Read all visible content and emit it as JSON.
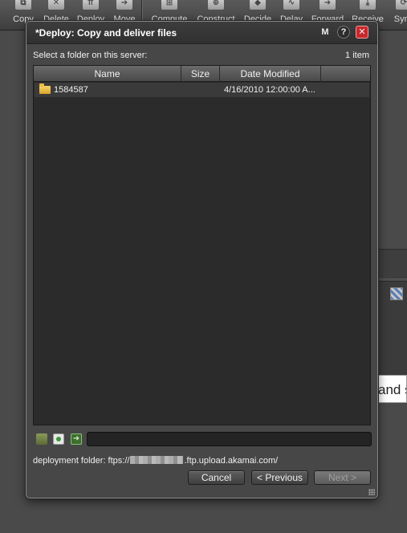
{
  "toolbar": {
    "items": [
      {
        "label": "Copy",
        "icon": "copy-icon",
        "glyph": "⧉"
      },
      {
        "label": "Delete",
        "icon": "delete-icon",
        "glyph": "✕"
      },
      {
        "label": "Deploy",
        "icon": "deploy-icon",
        "glyph": "⇈"
      },
      {
        "label": "Move",
        "icon": "move-icon",
        "glyph": "➔"
      },
      {
        "label": "Compute",
        "icon": "compute-icon",
        "glyph": "⊞"
      },
      {
        "label": "Construct",
        "icon": "construct-icon",
        "glyph": "⊕"
      },
      {
        "label": "Decide",
        "icon": "decide-icon",
        "glyph": "◆"
      },
      {
        "label": "Delay",
        "icon": "delay-icon",
        "glyph": "∿"
      },
      {
        "label": "Forward",
        "icon": "forward-icon",
        "glyph": "➜"
      },
      {
        "label": "Receive",
        "icon": "receive-icon",
        "glyph": "⤓"
      },
      {
        "label": "Sync",
        "icon": "sync-icon",
        "glyph": "⟳"
      }
    ]
  },
  "background": {
    "text_fragment": "and s"
  },
  "dialog": {
    "title": "*Deploy: Copy and deliver files",
    "title_buttons": {
      "m": "M",
      "help": "?",
      "close": "✕"
    },
    "select_label": "Select a folder on this server:",
    "item_count": "1 item",
    "columns": {
      "name": "Name",
      "size": "Size",
      "date": "Date Modified"
    },
    "rows": [
      {
        "name": "1584587",
        "size": "",
        "date": "4/16/2010 12:00:00 A..."
      }
    ],
    "path_value": "",
    "deployment_folder_prefix": "deployment folder: ftps://",
    "deployment_folder_suffix": ".ftp.upload.akamai.com/",
    "buttons": {
      "cancel": "Cancel",
      "previous": "< Previous",
      "next": "Next >"
    }
  }
}
